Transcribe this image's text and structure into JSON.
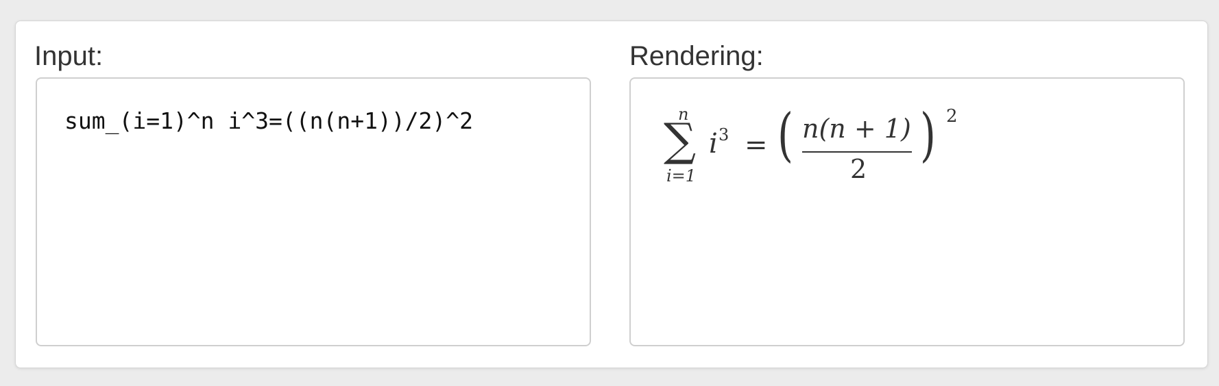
{
  "input": {
    "label": "Input:",
    "value": "sum_(i=1)^n i^3=((n(n+1))/2)^2"
  },
  "rendering": {
    "label": "Rendering:",
    "math": {
      "sigma": "∑",
      "upper": "n",
      "lower": "i=1",
      "base": "i",
      "exponent": "3",
      "equals": "=",
      "lparen": "(",
      "numerator": "n(n + 1)",
      "denominator": "2",
      "rparen": ")",
      "outer_exponent": "2"
    }
  }
}
